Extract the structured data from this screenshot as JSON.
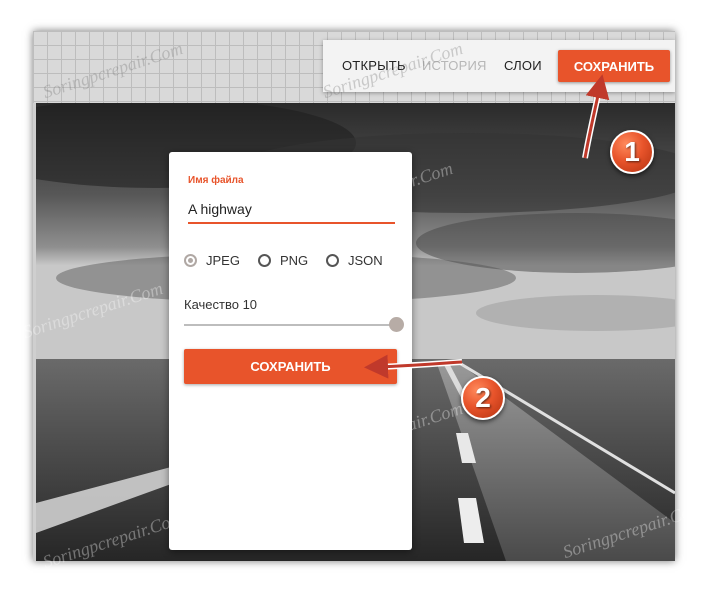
{
  "toolbar": {
    "open_label": "ОТКРЫТЬ",
    "history_label": "ИСТОРИЯ",
    "layers_label": "СЛОИ",
    "save_label": "СОХРАНИТЬ"
  },
  "dialog": {
    "filename_label": "Имя файла",
    "filename_value": "A highway",
    "formats": [
      {
        "label": "JPEG",
        "selected": true
      },
      {
        "label": "PNG",
        "selected": false
      },
      {
        "label": "JSON",
        "selected": false
      }
    ],
    "quality_label": "Качество 10",
    "quality_value": 10,
    "save_label": "СОХРАНИТЬ"
  },
  "steps": {
    "step1": "1",
    "step2": "2"
  },
  "watermark": "Soringpcrepair.Com",
  "colors": {
    "accent": "#e8542b",
    "inactive_text": "#b7b7b7"
  }
}
